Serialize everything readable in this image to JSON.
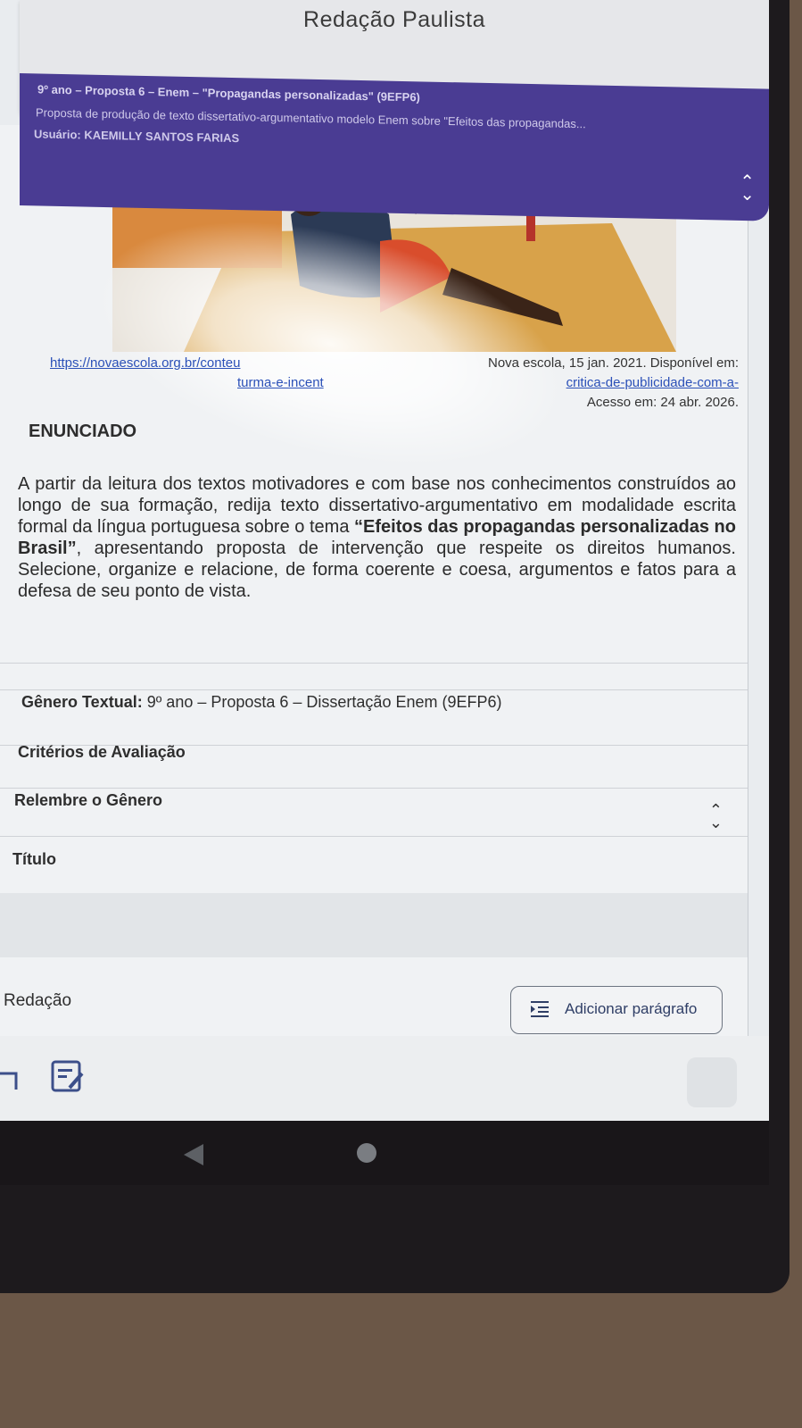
{
  "app": {
    "title": "Redação Paulista"
  },
  "banner": {
    "line1": "9º ano – Proposta 6 – Enem – \"Propagandas personalizadas\" (9EFP6)",
    "line2": "Proposta de produção de texto dissertativo-argumentativo modelo Enem sobre \"Efeitos das propagandas...",
    "line3": "Usuário: KAEMILLY SANTOS FARIAS",
    "toggle_icon": "chevron-updown-icon"
  },
  "credits": {
    "link_start": "https://novaescola.org.br/conteu",
    "source_text": "Nova escola, 15 jan. 2021. Disponível em:",
    "link_mid": "turma-e-incent",
    "link_end": "critica-de-publicidade-com-a-",
    "access": "Acesso em: 24 abr. 2026."
  },
  "statement": {
    "heading": "ENUNCIADO",
    "text_before": "A partir da leitura dos textos motivadores e com base nos conhecimentos construídos ao longo de sua formação, redija texto dissertativo-argumentativo em modalidade escrita formal da língua portuguesa sobre o tema ",
    "theme": "“Efeitos das propagandas personalizadas no Brasil”",
    "text_after": ", apresentando proposta de intervenção que respeite os direitos humanos. Selecione, organize e relacione, de forma coerente e coesa, argumentos e fatos para a defesa de seu ponto de vista."
  },
  "genre": {
    "label": "Gênero Textual:",
    "value": "9º ano – Proposta 6 – Dissertação Enem (9EFP6)"
  },
  "criteria": {
    "label": "Critérios de Avaliação"
  },
  "review": {
    "label": "Relembre o Gênero"
  },
  "title_field": {
    "label": "Título"
  },
  "essay": {
    "label": "Redação",
    "add_paragraph": "Adicionar parágrafo"
  },
  "colors": {
    "banner": "#4a3c93",
    "link": "#2b50b8",
    "background": "#f0f2f4"
  }
}
